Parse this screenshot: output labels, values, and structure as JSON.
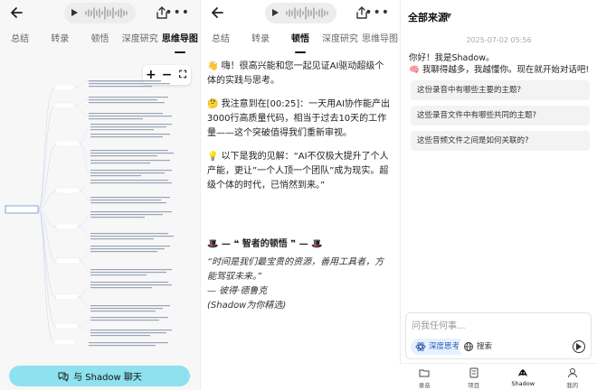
{
  "left_panel": {
    "tabs": [
      "总结",
      "转录",
      "顿悟",
      "深度研究",
      "思维导图"
    ],
    "active_tab": "思维导图",
    "zoom": {
      "plus": "+",
      "minus": "−",
      "fit": "⛶"
    },
    "chat_button": "与 Shadow 聊天",
    "icons": [
      "back-arrow-icon",
      "play-icon",
      "waveform-icon",
      "share-icon",
      "more-icon",
      "chat-bubble-icon"
    ]
  },
  "middle_panel": {
    "tabs": [
      "总结",
      "转录",
      "顿悟",
      "深度研究",
      "思维导图"
    ],
    "active_tab": "顿悟",
    "paragraphs": [
      "👋 嗨！很高兴能和您一起见证AI驱动超级个体的实践与思考。",
      "🤔 我注意到在[00:25]：一天用AI协作能产出3000行高质量代码，相当于过去10天的工作量——这个突破值得我们重新审视。",
      "💡 以下是我的见解：“AI不仅极大提升了个人产能，更让”一个人顶一个团队”成为现实。超级个体的时代，已悄然到来。”"
    ],
    "section_title": "🎩 — ❝ 智者的顿悟 ❞ — 🎩",
    "quote_lines": [
      "“时间是我们最宝贵的资源，善用工具者，方能驾驭未来。”",
      "— 彼得·德鲁克",
      "(Shadow为你精选)"
    ]
  },
  "right_panel": {
    "source_label": "全部来源",
    "timestamp": "2025-07-02 05:56",
    "greeting": [
      "你好！我是Shadow。",
      "🧠 我聊得越多，我越懂你。现在就开始对话吧!"
    ],
    "suggestions": [
      "这份录音中有哪些主要的主题?",
      "这些录音文件中有哪些共同的主题?",
      "这些音频文件之间是如何关联的?"
    ],
    "input_placeholder": "问我任何事...",
    "chips": {
      "deep": "深度思考",
      "search": "搜索"
    },
    "nav": [
      "录音",
      "项目",
      "Shadow",
      "我的"
    ],
    "active_nav": "Shadow"
  },
  "colors": {
    "accent_cyan": "#8ee1ee",
    "chip_blue": "#2a5db0",
    "mindmap_root": "#3d6fb6"
  }
}
